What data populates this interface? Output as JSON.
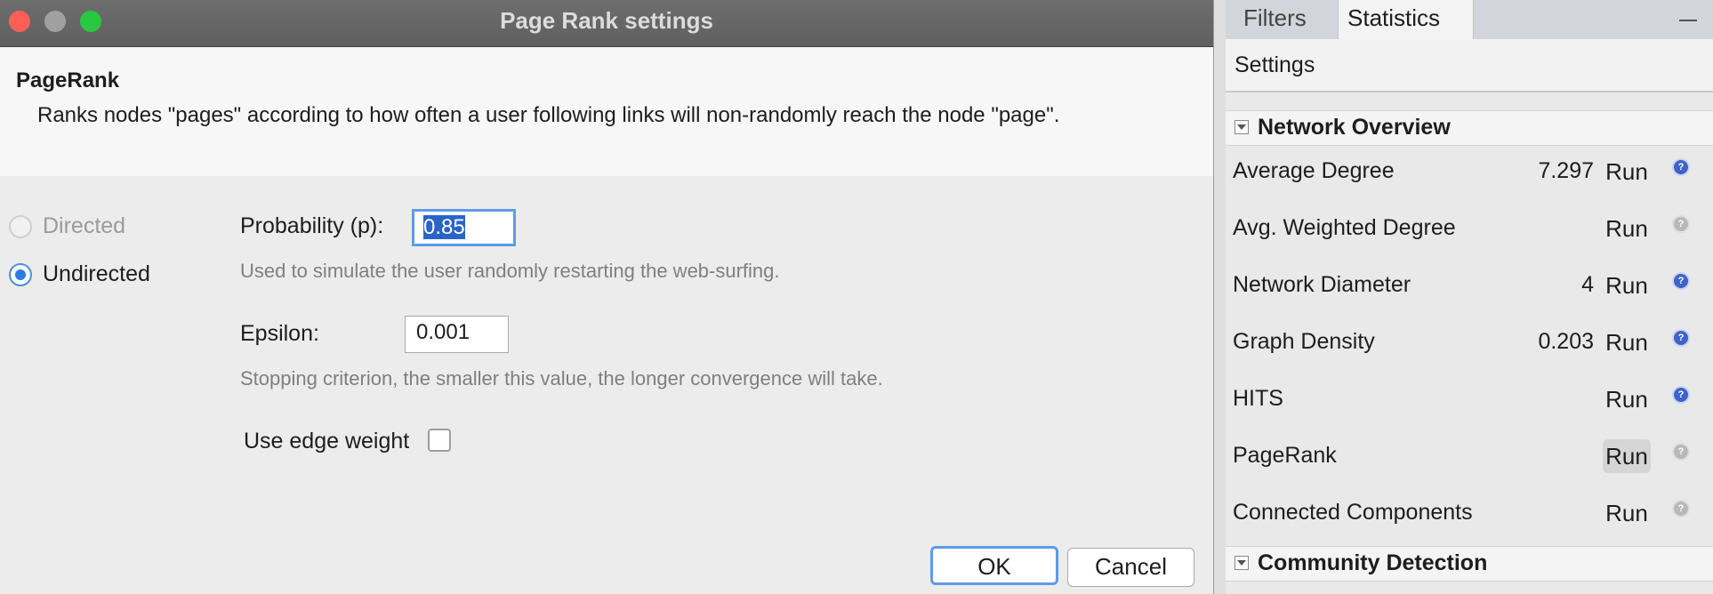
{
  "dialog": {
    "title": "Page Rank settings",
    "algorithm_title": "PageRank",
    "description": "Ranks nodes \"pages\" according to how often a user following links will non-randomly reach the node \"page\".",
    "graph_type": {
      "directed_label": "Directed",
      "undirected_label": "Undirected",
      "selected": "Undirected"
    },
    "probability": {
      "label": "Probability (p):",
      "value": "0.85",
      "help": "Used to simulate the user randomly restarting the web-surfing."
    },
    "epsilon": {
      "label": "Epsilon:",
      "value": "0.001",
      "help": "Stopping criterion, the smaller this value, the longer convergence will take."
    },
    "edge_weight": {
      "label": "Use edge weight",
      "checked": false
    },
    "ok_label": "OK",
    "cancel_label": "Cancel"
  },
  "panel": {
    "tabs": [
      {
        "label": "Filters"
      },
      {
        "label": "Statistics",
        "close": "×"
      }
    ],
    "settings_label": "Settings",
    "sections": [
      {
        "title": "Network Overview"
      },
      {
        "title": "Community Detection"
      }
    ],
    "rows": [
      {
        "name": "Average Degree",
        "value": "7.297",
        "run": "Run"
      },
      {
        "name": "Avg. Weighted Degree",
        "value": "",
        "run": "Run"
      },
      {
        "name": "Network Diameter",
        "value": "4",
        "run": "Run"
      },
      {
        "name": "Graph Density",
        "value": "0.203",
        "run": "Run"
      },
      {
        "name": "HITS",
        "value": "",
        "run": "Run"
      },
      {
        "name": "PageRank",
        "value": "",
        "run": "Run"
      },
      {
        "name": "Connected Components",
        "value": "",
        "run": "Run"
      }
    ],
    "info_glyph": "?"
  },
  "colors": {
    "close": "#fe5f57",
    "minimize": "#a0a0a0",
    "zoom": "#28c840",
    "accent": "#2d7de0",
    "info": "#3f63c8"
  }
}
